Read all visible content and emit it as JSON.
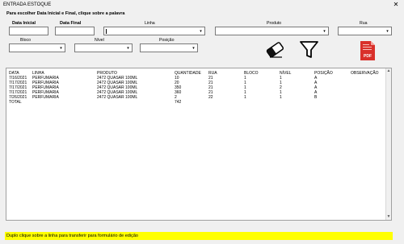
{
  "window": {
    "title": "ENTRADA ESTOQUE",
    "close_glyph": "✕"
  },
  "hint": "Para escolher Data Inicial e Final, clique sobre a palavra",
  "filters": {
    "data_inicial_label": "Data Inicial",
    "data_final_label": "Data Final",
    "linha_label": "Linha",
    "produto_label": "Produto",
    "rua_label": "Rua",
    "bloco_label": "Bloco",
    "nivel_label": "Nível",
    "posicao_label": "Posição",
    "dropdown_glyph": "▾"
  },
  "toolbar": {
    "eraser_icon": "eraser-icon",
    "filter_icon": "filter-icon",
    "pdf_icon": "pdf-icon",
    "pdf_label": "PDF",
    "pdf_color": "#d9302a"
  },
  "table": {
    "columns": [
      "DATA",
      "LINHA",
      "PRODUTO",
      "QUANTIDADE",
      "RUA",
      "BLOCO",
      "NÍVEL",
      "POSIÇÃO",
      "OBSERVAÇÃO"
    ],
    "rows": [
      [
        "7/16/2021",
        "PERFUMARIA",
        "2472 QUASAR 100ML",
        "10",
        "21",
        "1",
        "1",
        "A",
        ""
      ],
      [
        "7/17/2021",
        "PERFUMARIA",
        "2472 QUASAR 100ML",
        "20",
        "21",
        "1",
        "1",
        "A",
        ""
      ],
      [
        "7/17/2021",
        "PERFUMARIA",
        "2472 QUASAR 100ML",
        "350",
        "21",
        "1",
        "2",
        "A",
        ""
      ],
      [
        "7/17/2021",
        "PERFUMARIA",
        "2472 QUASAR 100ML",
        "360",
        "21",
        "1",
        "1",
        "A",
        ""
      ],
      [
        "7/26/2021",
        "PERFUMARIA",
        "2472 QUASAR 100ML",
        "2",
        "22",
        "1",
        "1",
        "B",
        ""
      ]
    ],
    "total_label": "TOTAL",
    "total_value": "742",
    "scroll_up_glyph": "▲",
    "scroll_down_glyph": "▼"
  },
  "status": {
    "text": "Duplo clique sobre a linha para transferir para formulário de edição",
    "color": "#ffff00"
  }
}
